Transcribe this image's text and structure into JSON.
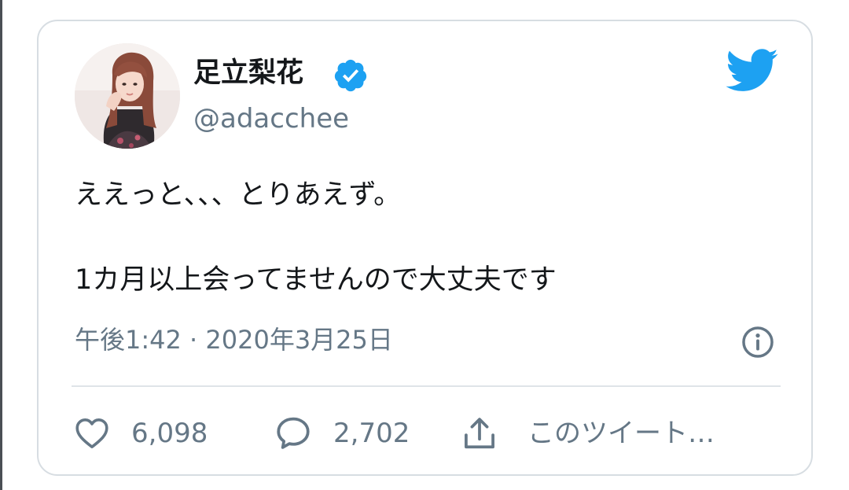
{
  "tweet": {
    "display_name": "足立梨花",
    "handle": "@adacchee",
    "text_line_1": "ええっと、、、とりあえず。",
    "text_line_2": "1カ月以上会ってませんので大丈夫です",
    "timestamp": "午後1:42 · 2020年3月25日"
  },
  "actions": {
    "likes": "6,098",
    "replies": "2,702",
    "share_label": "このツイート…"
  },
  "icons": {
    "verified": "verified-badge-icon",
    "brand": "twitter-bird-icon",
    "info": "info-icon",
    "like": "heart-icon",
    "reply": "speech-bubble-icon",
    "share": "share-upload-icon"
  },
  "colors": {
    "brand_blue": "#1da1f2",
    "text_primary": "#14171a",
    "text_secondary": "#657786",
    "border": "#d7dde2"
  }
}
